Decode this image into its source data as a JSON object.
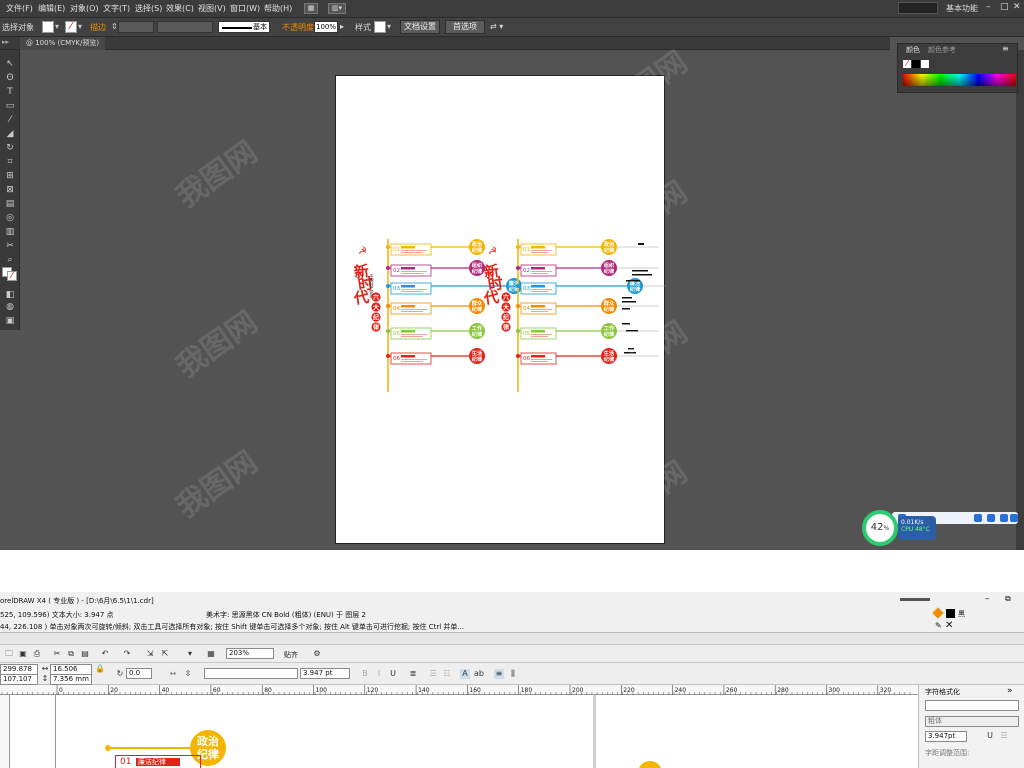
{
  "illustrator": {
    "menu": [
      "文件(F)",
      "编辑(E)",
      "对象(O)",
      "文字(T)",
      "选择(S)",
      "效果(C)",
      "视图(V)",
      "窗口(W)",
      "帮助(H)"
    ],
    "workspace": "基本功能",
    "control": {
      "selection": "选择对象",
      "stroke_label": "描边",
      "stroke_style": "基本",
      "opacity_label": "不透明度",
      "opacity_value": "100%",
      "style_label": "样式",
      "doc_setup": "文档设置",
      "preferences": "首选项"
    },
    "tab": "@ 100% (CMYK/预览)",
    "panel_tabs": [
      "颜色",
      "颜色参考"
    ],
    "monitor": {
      "percent": "42",
      "percent_unit": "%",
      "speed": "0.01K/s",
      "cpu": "CPU 48°C"
    }
  },
  "artwork": {
    "left": {
      "headline": [
        "新",
        "时",
        "代"
      ],
      "subtitle": "中国共产党的",
      "badge": "六大纪律",
      "circles": [
        {
          "t1": "政治",
          "t2": "纪律",
          "color": "#f4b400"
        },
        {
          "t1": "组织",
          "t2": "纪律",
          "color": "#b0277c"
        },
        {
          "t1": "廉洁",
          "t2": "纪律",
          "color": "#1a9ad6"
        },
        {
          "t1": "群众",
          "t2": "纪律",
          "color": "#f08c00"
        },
        {
          "t1": "工作",
          "t2": "纪律",
          "color": "#8cc63f"
        },
        {
          "t1": "生活",
          "t2": "纪律",
          "color": "#e2231a"
        }
      ],
      "numbers": [
        "01",
        "02",
        "03",
        "04",
        "05",
        "06"
      ]
    },
    "right": {
      "headline": [
        "新",
        "时",
        "代"
      ],
      "badge": "六大纪律",
      "circles": [
        {
          "t1": "政治",
          "t2": "纪律",
          "color": "#f4b400"
        },
        {
          "t1": "组织",
          "t2": "纪律",
          "color": "#b0277c"
        },
        {
          "t1": "廉洁",
          "t2": "纪律",
          "color": "#1a9ad6"
        },
        {
          "t1": "群众",
          "t2": "纪律",
          "color": "#f08c00"
        },
        {
          "t1": "工作",
          "t2": "纪律",
          "color": "#8cc63f"
        },
        {
          "t1": "生活",
          "t2": "纪律",
          "color": "#e2231a"
        }
      ],
      "numbers": [
        "01",
        "02",
        "03",
        "04",
        "05",
        "06"
      ]
    }
  },
  "coreldraw": {
    "title": "orelDRAW X4 ( 专业版 ) - [D:\\6月\\6.5\\1\\1.cdr]",
    "status_line1": "525, 109.596) 文本大小: 3.947 点",
    "status_font": "美术字: 思源黑体 CN Bold (粗体) (ENU) 于 图层 2",
    "status_line2": "44, 226.108 )      单击对象两次可旋转/倾斜; 双击工具可选择所有对象; 按住 Shift 键单击可选择多个对象; 按住 Alt 键单击可进行挖掘; 按住 Ctrl 并单...",
    "fill_label": "黑",
    "zoom": "203%",
    "snap": "贴齐",
    "pos_x": "299.878 mm",
    "pos_y": "107.107 mm",
    "size_w": "16.506 mm",
    "size_h": "7.356 mm",
    "rotation": "0.0",
    "font_size": "3.947 pt",
    "ruler_ticks": [
      "0",
      "20",
      "40",
      "60",
      "80",
      "100",
      "120",
      "140",
      "160",
      "180",
      "200",
      "220",
      "240",
      "260",
      "280",
      "300",
      "320"
    ],
    "docker": {
      "title": "字符格式化",
      "weight": "粗体",
      "size": "3.947pt",
      "kerning": "字距调整范围:"
    },
    "canvas_circle": {
      "t1": "政治",
      "t2": "纪律"
    },
    "canvas_row": {
      "num": "01",
      "label": "廉洁纪律"
    }
  },
  "watermark": "我图网"
}
